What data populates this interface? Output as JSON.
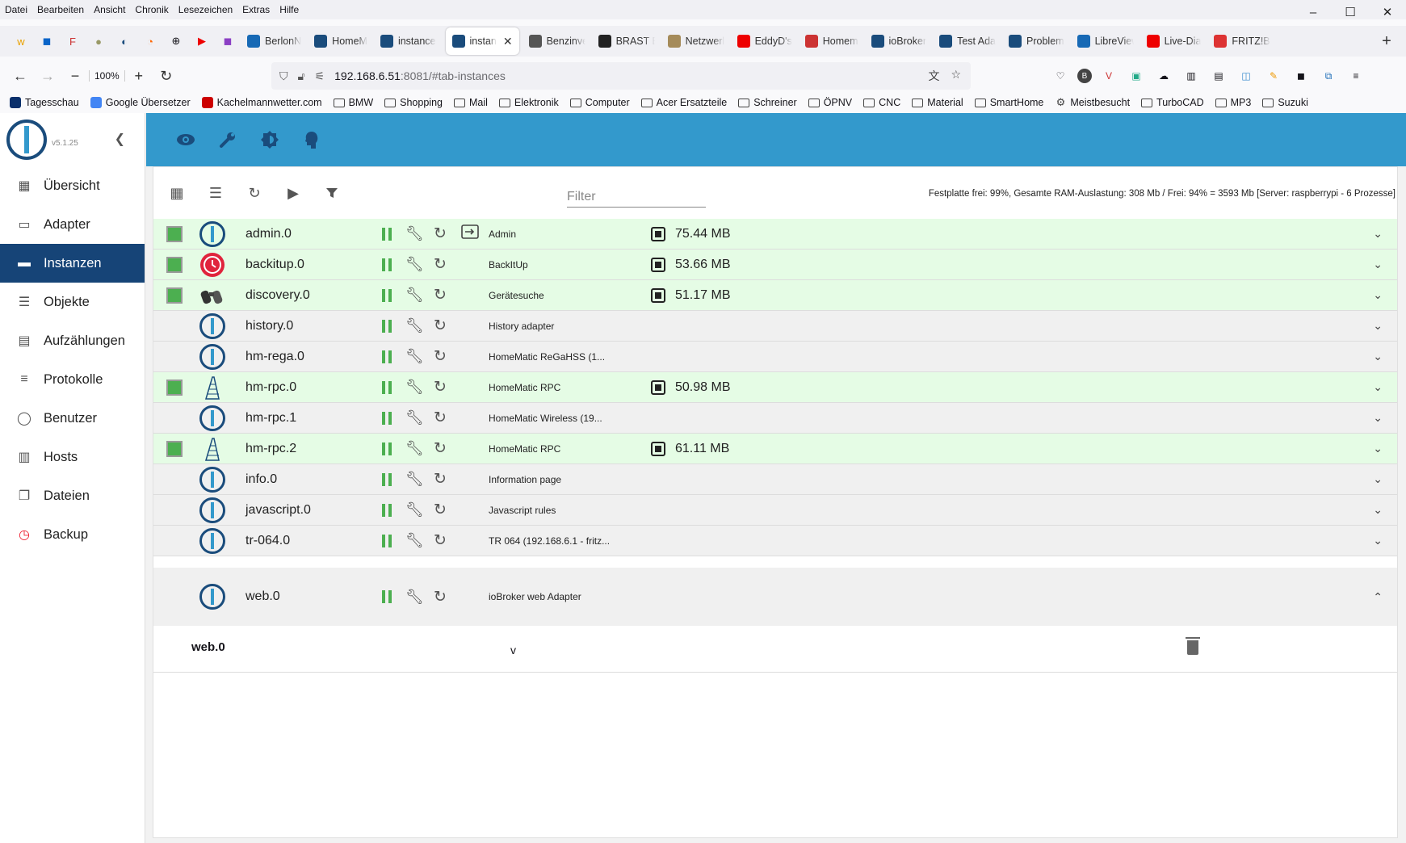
{
  "menu": [
    "Datei",
    "Bearbeiten",
    "Ansicht",
    "Chronik",
    "Lesezeichen",
    "Extras",
    "Hilfe"
  ],
  "window": {
    "minimize": "–",
    "maximize": "☐",
    "close": "✕"
  },
  "tabs": [
    {
      "label": "BerlonN",
      "color": "#1769b5"
    },
    {
      "label": "HomeM",
      "color": "#1a4c7c"
    },
    {
      "label": "instance",
      "color": "#1a4c7c"
    },
    {
      "label": "instan",
      "color": "#1a4c7c",
      "active": true
    },
    {
      "label": "Benzinve",
      "color": "#555"
    },
    {
      "label": "BRAST B",
      "color": "#222"
    },
    {
      "label": "Netzwerl",
      "color": "#a58b5a"
    },
    {
      "label": "EddyD's",
      "color": "#e00"
    },
    {
      "label": "Homem",
      "color": "#c33"
    },
    {
      "label": "ioBroker",
      "color": "#1a4c7c"
    },
    {
      "label": "Test Ada",
      "color": "#1a4c7c"
    },
    {
      "label": "Problem",
      "color": "#1a4c7c"
    },
    {
      "label": "LibreView",
      "color": "#1769b5"
    },
    {
      "label": "Live-Dia",
      "color": "#e00"
    },
    {
      "label": "FRITZ!Bo",
      "color": "#d33"
    }
  ],
  "nav": {
    "zoom": "100%",
    "url_host": "192.168.6.51",
    "url_path": ":8081/#tab-instances"
  },
  "bookmarks": [
    {
      "label": "Tagesschau",
      "type": "icon",
      "color": "#0a2f6b"
    },
    {
      "label": "Google Übersetzer",
      "type": "icon",
      "color": "#4285f4"
    },
    {
      "label": "Kachelmannwetter.com",
      "type": "icon",
      "color": "#c00"
    },
    {
      "label": "BMW",
      "type": "folder"
    },
    {
      "label": "Shopping",
      "type": "folder"
    },
    {
      "label": "Mail",
      "type": "folder"
    },
    {
      "label": "Elektronik",
      "type": "folder"
    },
    {
      "label": "Computer",
      "type": "folder"
    },
    {
      "label": "Acer Ersatzteile",
      "type": "folder"
    },
    {
      "label": "Schreiner",
      "type": "folder"
    },
    {
      "label": "ÖPNV",
      "type": "folder"
    },
    {
      "label": "CNC",
      "type": "folder"
    },
    {
      "label": "Material",
      "type": "folder"
    },
    {
      "label": "SmartHome",
      "type": "folder"
    },
    {
      "label": "Meistbesucht",
      "type": "gear"
    },
    {
      "label": "TurboCAD",
      "type": "folder"
    },
    {
      "label": "MP3",
      "type": "folder"
    },
    {
      "label": "Suzuki",
      "type": "folder"
    }
  ],
  "app": {
    "version": "v5.1.25",
    "sidebar": [
      {
        "label": "Übersicht",
        "icon": "grid-icon"
      },
      {
        "label": "Adapter",
        "icon": "store-icon"
      },
      {
        "label": "Instanzen",
        "icon": "instances-icon",
        "active": true
      },
      {
        "label": "Objekte",
        "icon": "list-icon"
      },
      {
        "label": "Aufzählungen",
        "icon": "enum-icon"
      },
      {
        "label": "Protokolle",
        "icon": "log-icon"
      },
      {
        "label": "Benutzer",
        "icon": "user-icon"
      },
      {
        "label": "Hosts",
        "icon": "hosts-icon"
      },
      {
        "label": "Dateien",
        "icon": "files-icon"
      },
      {
        "label": "Backup",
        "icon": "backup-icon"
      }
    ],
    "filter_placeholder": "Filter",
    "stats": "Festplatte frei: 99%, Gesamte RAM-Auslastung: 308 Mb / Frei: 94% = 3593 Mb [Server: raspberrypi - 6 Prozesse]",
    "instances": [
      {
        "name": "admin.0",
        "title": "Admin",
        "mem": "75.44 MB",
        "enabled": true,
        "icon": "iobroker",
        "link": true
      },
      {
        "name": "backitup.0",
        "title": "BackItUp",
        "mem": "53.66 MB",
        "enabled": true,
        "icon": "backitup"
      },
      {
        "name": "discovery.0",
        "title": "Gerätesuche",
        "mem": "51.17 MB",
        "enabled": true,
        "icon": "binoculars"
      },
      {
        "name": "history.0",
        "title": "History adapter",
        "mem": "",
        "enabled": false,
        "icon": "iobroker"
      },
      {
        "name": "hm-rega.0",
        "title": "HomeMatic ReGaHSS (1...",
        "mem": "",
        "enabled": false,
        "icon": "iobroker"
      },
      {
        "name": "hm-rpc.0",
        "title": "HomeMatic RPC",
        "mem": "50.98 MB",
        "enabled": true,
        "icon": "homematic"
      },
      {
        "name": "hm-rpc.1",
        "title": "HomeMatic Wireless (19...",
        "mem": "",
        "enabled": false,
        "icon": "iobroker"
      },
      {
        "name": "hm-rpc.2",
        "title": "HomeMatic RPC",
        "mem": "61.11 MB",
        "enabled": true,
        "icon": "homematic"
      },
      {
        "name": "info.0",
        "title": "Information page",
        "mem": "",
        "enabled": false,
        "icon": "iobroker"
      },
      {
        "name": "javascript.0",
        "title": "Javascript rules",
        "mem": "",
        "enabled": false,
        "icon": "iobroker"
      },
      {
        "name": "tr-064.0",
        "title": "TR 064 (192.168.6.1 - fritz...",
        "mem": "",
        "enabled": false,
        "icon": "iobroker"
      }
    ],
    "expanded": {
      "name": "web.0",
      "title": "ioBroker web Adapter",
      "detail_name": "web.0",
      "detail_value": "v"
    }
  }
}
